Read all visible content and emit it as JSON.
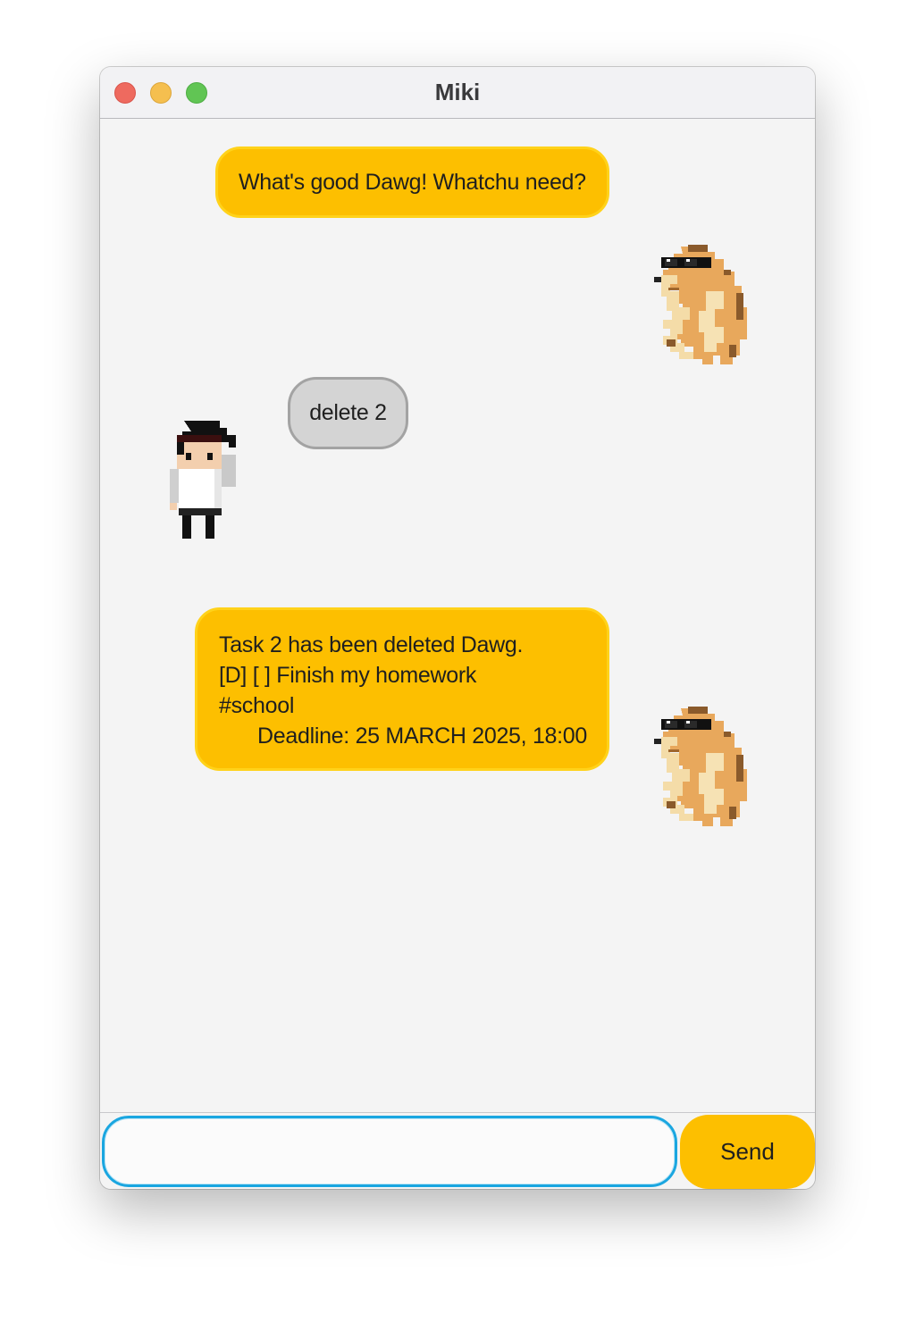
{
  "window": {
    "title": "Miki"
  },
  "chat": {
    "messages": [
      {
        "sender": "miki",
        "text": "What's good Dawg! Whatchu need?",
        "avatar": "cheems-dog-sunglasses-icon"
      },
      {
        "sender": "user",
        "text": "delete 2",
        "avatar": "pixel-boy-icon"
      },
      {
        "sender": "miki",
        "lines": [
          "Task 2 has been deleted Dawg.",
          "[D] [ ]  Finish my homework",
          "#school",
          "Deadline: 25 MARCH 2025, 18:00"
        ],
        "avatar": "cheems-dog-sunglasses-icon"
      }
    ]
  },
  "input": {
    "value": "",
    "placeholder": ""
  },
  "send_button": {
    "label": "Send"
  },
  "colors": {
    "miki_bubble": "#fdbf00",
    "user_bubble": "#d4d4d4",
    "input_focus": "#1aa6e0",
    "send_button": "#fdbf00"
  }
}
